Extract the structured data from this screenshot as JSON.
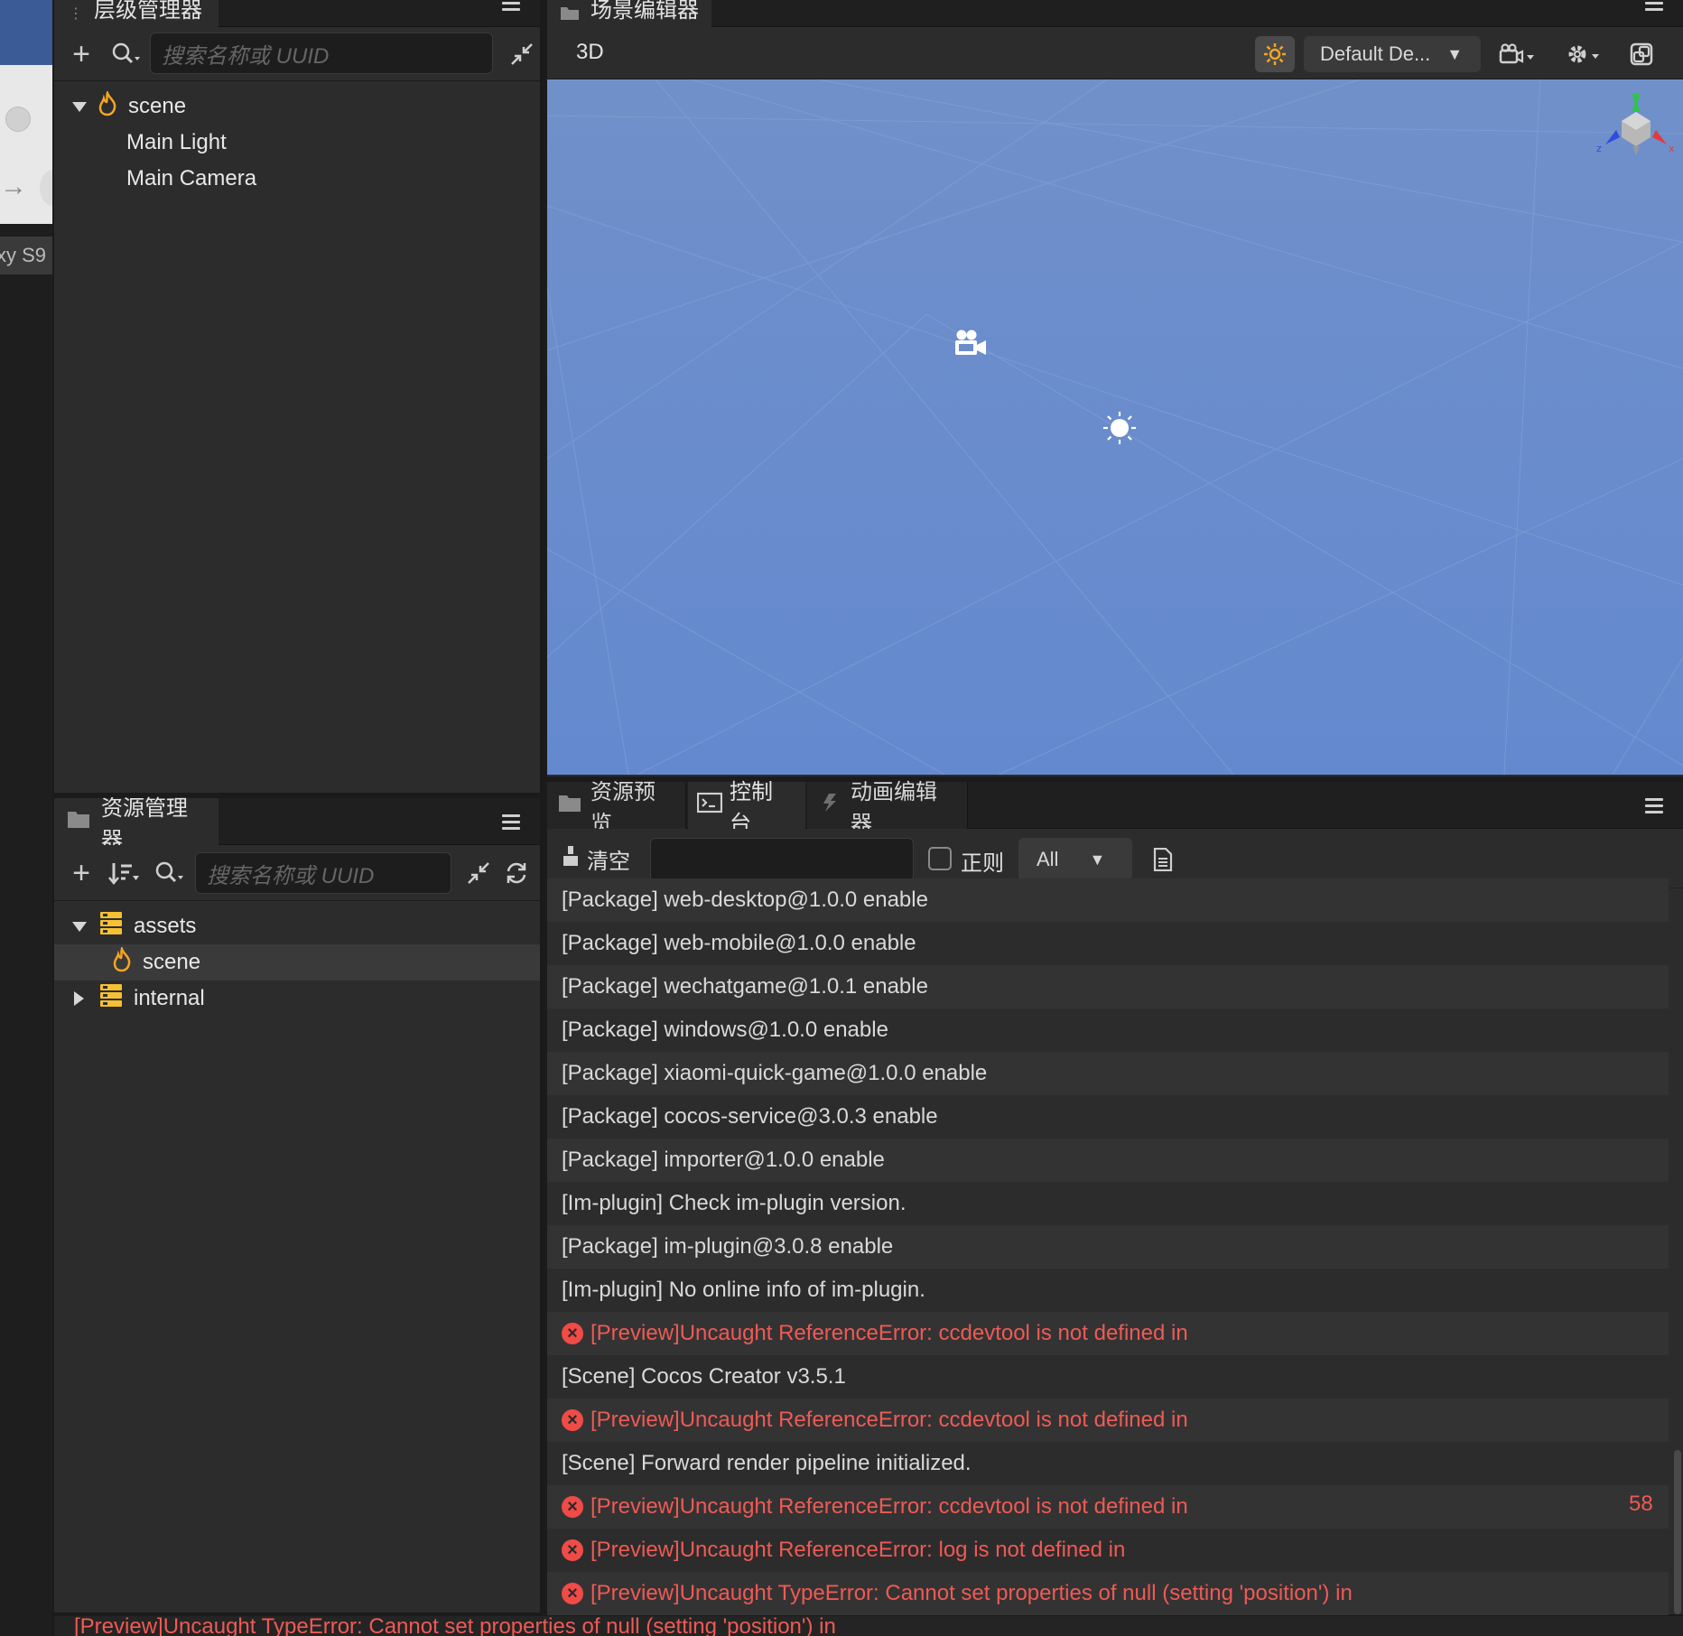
{
  "sliver": {
    "label": "xy S9"
  },
  "hierarchy": {
    "title": "层级管理器",
    "search_placeholder": "搜索名称或 UUID",
    "nodes": [
      {
        "label": "scene",
        "icon": "scene-flame-icon"
      },
      {
        "label": "Main Light"
      },
      {
        "label": "Main Camera"
      }
    ]
  },
  "assets": {
    "title": "资源管理器",
    "search_placeholder": "搜索名称或 UUID",
    "nodes": [
      {
        "label": "assets",
        "icon": "database-icon"
      },
      {
        "label": "scene",
        "icon": "scene-flame-icon"
      },
      {
        "label": "internal",
        "icon": "database-icon"
      }
    ]
  },
  "scene_editor": {
    "title": "场景编辑器",
    "mode": "3D",
    "layout_select": "Default De...",
    "gizmo_axes": {
      "x": "x",
      "y": "y",
      "z": "z"
    }
  },
  "bottom_tabs": [
    {
      "label": "资源预览",
      "icon": "folder-icon"
    },
    {
      "label": "控制台",
      "icon": "terminal-icon"
    },
    {
      "label": "动画编辑器",
      "icon": "animation-icon"
    }
  ],
  "console": {
    "clear_label": "清空",
    "regex_label": "正则",
    "filter_value": "All",
    "badge_count": "58",
    "logs": [
      {
        "text": "[Package] web-desktop@1.0.0 enable",
        "level": "info"
      },
      {
        "text": "[Package] web-mobile@1.0.0 enable",
        "level": "info"
      },
      {
        "text": "[Package] wechatgame@1.0.1 enable",
        "level": "info"
      },
      {
        "text": "[Package] windows@1.0.0 enable",
        "level": "info"
      },
      {
        "text": "[Package] xiaomi-quick-game@1.0.0 enable",
        "level": "info"
      },
      {
        "text": "[Package] cocos-service@3.0.3 enable",
        "level": "info"
      },
      {
        "text": "[Package] importer@1.0.0 enable",
        "level": "info"
      },
      {
        "text": "[Im-plugin] Check im-plugin version.",
        "level": "info"
      },
      {
        "text": "[Package] im-plugin@3.0.8 enable",
        "level": "info"
      },
      {
        "text": "[Im-plugin] No online info of im-plugin.",
        "level": "info"
      },
      {
        "text": "[Preview]Uncaught ReferenceError: ccdevtool is not defined in",
        "level": "error"
      },
      {
        "text": "[Scene] Cocos Creator v3.5.1",
        "level": "info"
      },
      {
        "text": "[Preview]Uncaught ReferenceError: ccdevtool is not defined in",
        "level": "error"
      },
      {
        "text": "[Scene] Forward render pipeline initialized.",
        "level": "info"
      },
      {
        "text": "[Preview]Uncaught ReferenceError: ccdevtool is not defined in",
        "level": "error"
      },
      {
        "text": "[Preview]Uncaught ReferenceError: log is not defined in",
        "level": "error"
      },
      {
        "text": "[Preview]Uncaught TypeError: Cannot set properties of null (setting 'position') in",
        "level": "error"
      }
    ]
  },
  "status_bar": {
    "text": "[Preview]Uncaught TypeError: Cannot set properties of null (setting 'position') in"
  },
  "colors": {
    "accent_orange": "#f5a623",
    "error_red": "#ef5a55",
    "scene_blue": "#6b8dcc",
    "panel_bg": "#2c2c2c"
  }
}
